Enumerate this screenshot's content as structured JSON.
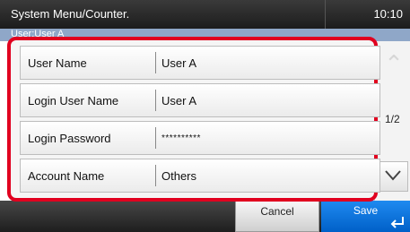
{
  "header": {
    "title": "System Menu/Counter.",
    "time": "10:10",
    "subtitle": "User:User A"
  },
  "form": {
    "rows": [
      {
        "label": "User Name",
        "value": "User A"
      },
      {
        "label": "Login User Name",
        "value": "User A"
      },
      {
        "label": "Login Password",
        "value": "**********"
      },
      {
        "label": "Account Name",
        "value": "Others"
      }
    ]
  },
  "pager": {
    "page": "1/2",
    "up_icon": "chevron-up-icon",
    "down_icon": "chevron-down-icon"
  },
  "footer": {
    "cancel_label": "Cancel",
    "save_label": "Save",
    "enter_icon": "enter-icon"
  },
  "colors": {
    "highlight": "#e1001f",
    "save": "#0a72de",
    "header": "#2a2a2a"
  }
}
